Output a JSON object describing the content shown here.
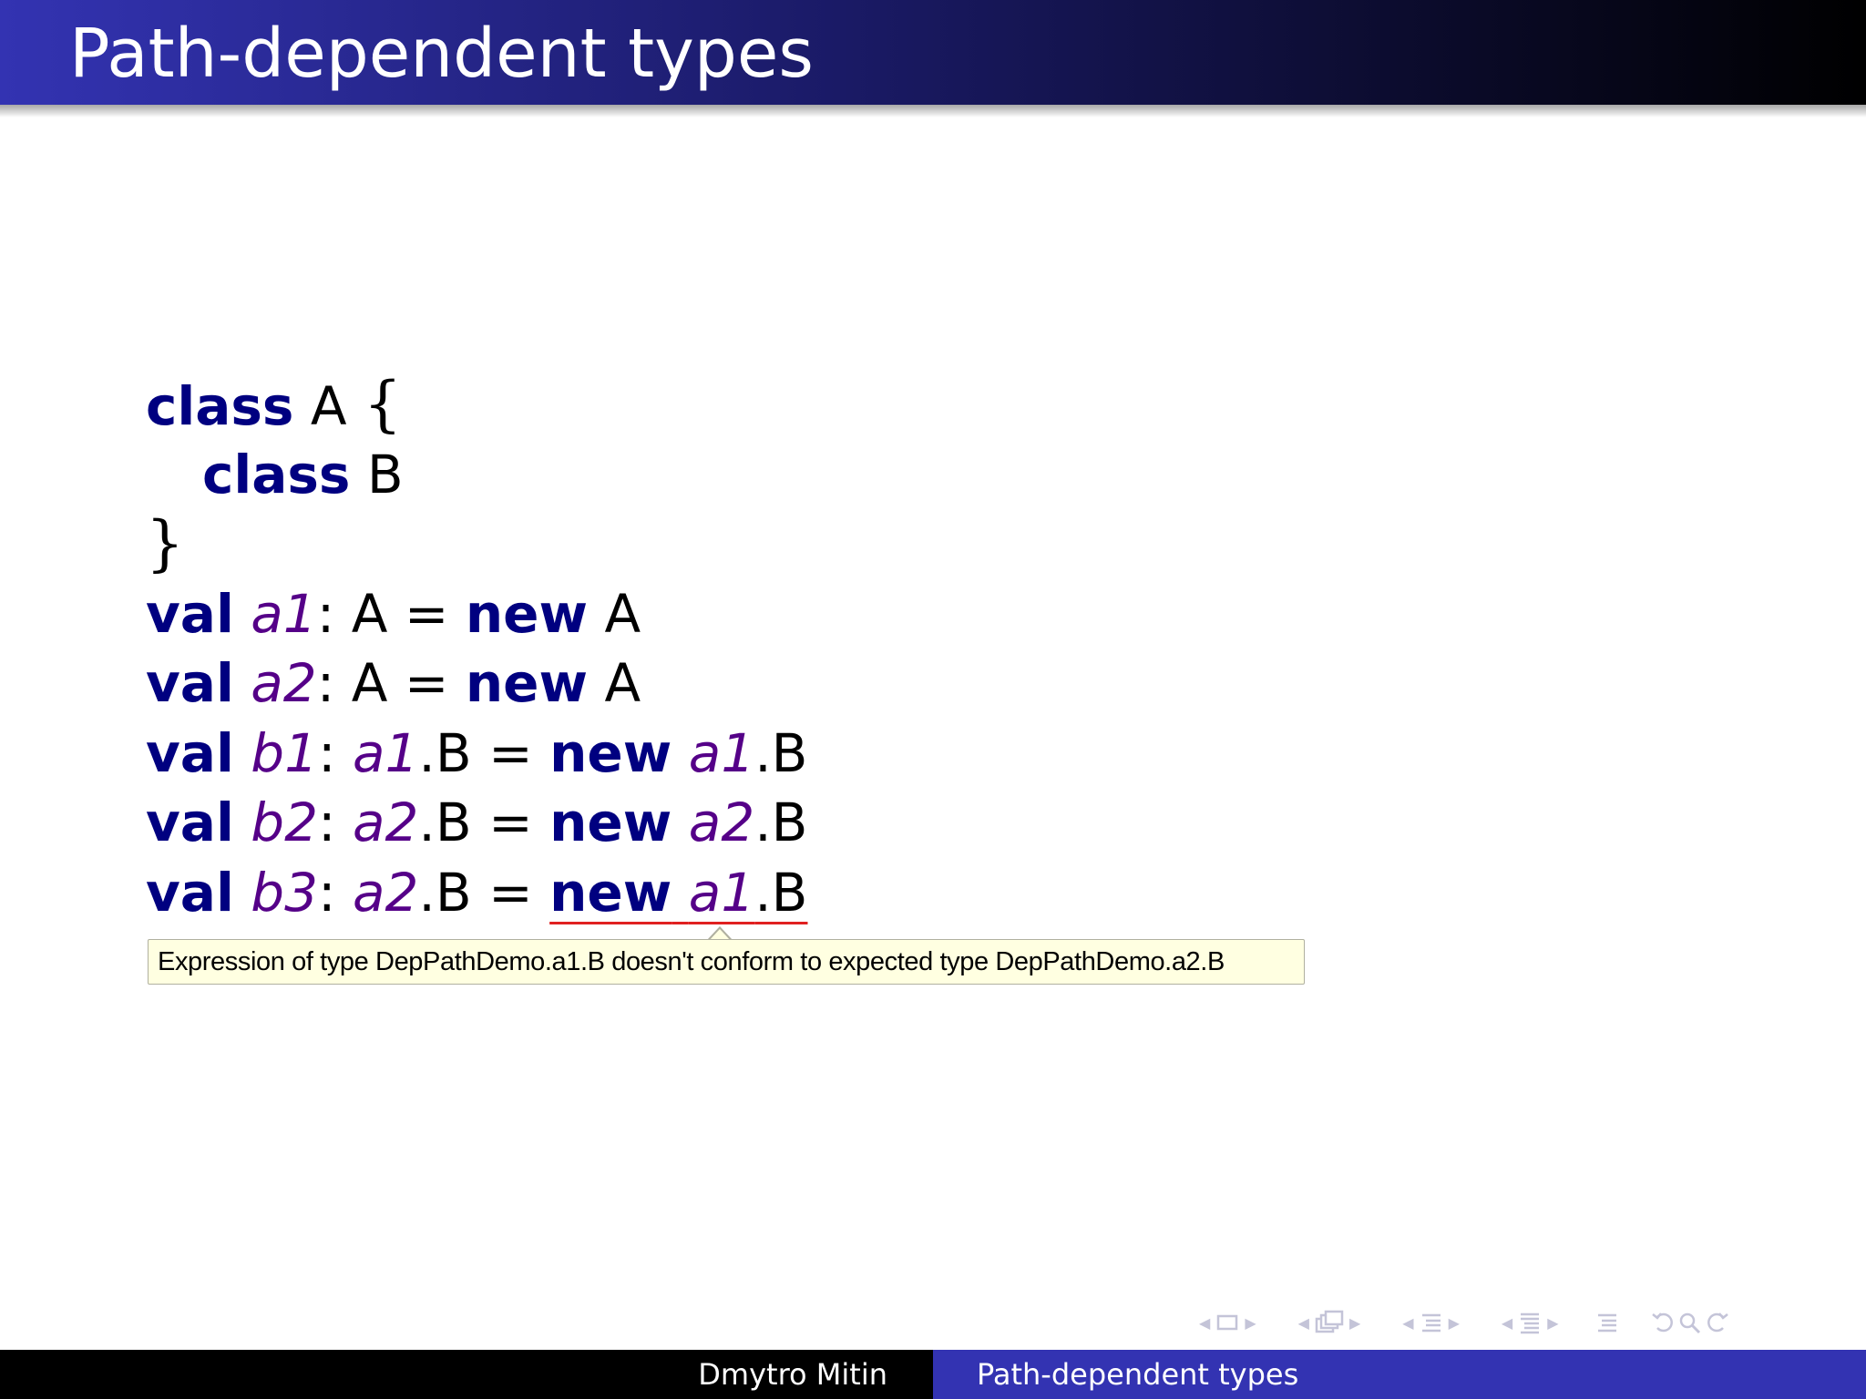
{
  "slide": {
    "title": "Path-dependent types"
  },
  "code": {
    "class_kw": "class",
    "val_kw": "val",
    "new_kw": "new",
    "type_a": "A",
    "type_b": "B",
    "open_brace": "{",
    "close_brace": "}",
    "colon": ":",
    "equals": "=",
    "dot_b": ".B",
    "vars": {
      "a1": "a1",
      "a2": "a2",
      "b1": "b1",
      "b2": "b2",
      "b3": "b3"
    }
  },
  "tooltip": {
    "text": "Expression of type DepPathDemo.a1.B doesn't conform to expected type DepPathDemo.a2.B"
  },
  "footer": {
    "author": "Dmytro Mitin",
    "title": "Path-dependent types"
  },
  "nav_icons": [
    "slide-nav-icon",
    "frame-nav-icon",
    "subsection-nav-icon",
    "section-nav-icon",
    "toc-icon",
    "undo-icon",
    "search-icon",
    "redo-icon"
  ]
}
